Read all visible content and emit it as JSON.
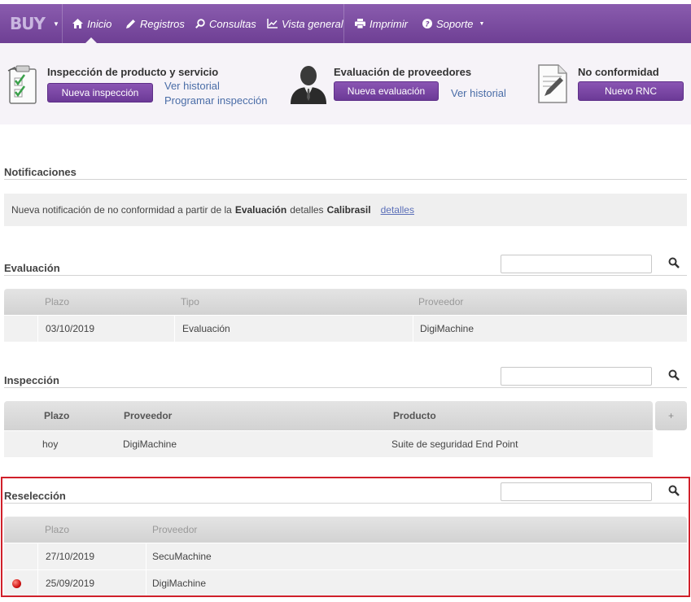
{
  "nav": {
    "brand": "BUY",
    "items": [
      {
        "label": "Inicio",
        "icon": "home-icon"
      },
      {
        "label": "Registros",
        "icon": "pencil-icon"
      },
      {
        "label": "Consultas",
        "icon": "search-icon"
      },
      {
        "label": "Vista general",
        "icon": "chart-icon"
      },
      {
        "label": "Imprimir",
        "icon": "printer-icon"
      },
      {
        "label": "Soporte",
        "icon": "help-icon"
      }
    ],
    "active": "Inicio"
  },
  "quick_actions": {
    "inspection": {
      "title": "Inspección de producto y servicio",
      "button": "Nueva inspección",
      "link_history": "Ver historial",
      "link_schedule": "Programar inspección"
    },
    "evaluation": {
      "title": "Evaluación de proveedores",
      "button": "Nueva evaluación",
      "link_history": "Ver historial"
    },
    "nonconformity": {
      "title": "No conformidad",
      "button": "Nuevo RNC"
    }
  },
  "notifications": {
    "title": "Notificaciones",
    "message_prefix": "Nueva notificación de no conformidad a partir de la",
    "message_bold1": "Evaluación",
    "message_mid": "detalles",
    "message_bold2": "Calibrasil",
    "link": "detalles"
  },
  "evaluation_section": {
    "title": "Evaluación",
    "columns": [
      "Plazo",
      "Tipo",
      "Proveedor"
    ],
    "rows": [
      {
        "plazo": "03/10/2019",
        "tipo": "Evaluación",
        "proveedor": "DigiMachine"
      }
    ]
  },
  "inspection_section": {
    "title": "Inspección",
    "columns": [
      "Plazo",
      "Proveedor",
      "Producto"
    ],
    "add_label": "+",
    "rows": [
      {
        "plazo": "hoy",
        "proveedor": "DigiMachine",
        "producto": "Suite de seguridad End Point"
      }
    ]
  },
  "reselection_section": {
    "title": "Reselección",
    "columns": [
      "Plazo",
      "Proveedor"
    ],
    "rows": [
      {
        "plazo": "27/10/2019",
        "proveedor": "SecuMachine",
        "status": ""
      },
      {
        "plazo": "25/09/2019",
        "proveedor": "DigiMachine",
        "status": "red-dot"
      }
    ]
  },
  "colors": {
    "nav_top": "#8a5cae",
    "nav_bottom": "#6e3f94",
    "button": "#7a47a5",
    "highlight": "#d0202a",
    "status_red": "#d01414"
  }
}
